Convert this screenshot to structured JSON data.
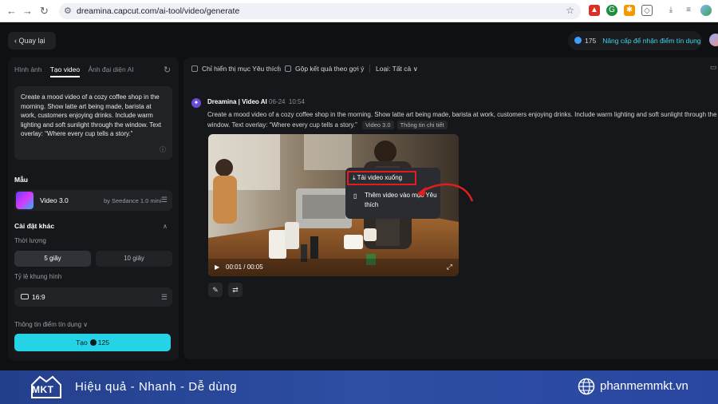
{
  "browser": {
    "url": "dreamina.capcut.com/ai-tool/video/generate"
  },
  "header": {
    "back_label": "Quay lại",
    "credits": "175",
    "upgrade_label": "Nâng cấp để nhận điểm tín dụng"
  },
  "left_panel": {
    "tabs": [
      "Hình ảnh",
      "Tạo video",
      "Ảnh đại diện AI"
    ],
    "prompt": "Create a mood video of a cozy coffee shop in the morning. Show latte art being made, barista at work, customers enjoying drinks. Include warm lighting and soft sunlight through the window. Text overlay: “Where every cup tells a story.”",
    "model_section": "Mẫu",
    "model_name": "Video 3.0",
    "model_sub": "by Seedance 1.0 mini",
    "other_settings": "Cài đặt khác",
    "duration_label": "Thời lượng",
    "duration_options": [
      "5 giây",
      "10 giây"
    ],
    "ratio_label": "Tỷ lệ khung hình",
    "ratio_value": "16:9",
    "credit_info": "Thông tin điểm tín dụng",
    "create_label": "Tạo",
    "create_cost": "125"
  },
  "right_panel": {
    "filters": {
      "favorites_only": "Chỉ hiển thị mục Yêu thích",
      "group_by_prompt": "Gộp kết quả theo gợi ý",
      "type_label": "Loại: Tất cả"
    },
    "generation": {
      "author": "Dreamina | Video AI",
      "date": "06-24",
      "time": "10:54",
      "prompt": "Create a mood video of a cozy coffee shop in the morning. Show latte art being made, barista at work, customers enjoying drinks. Include warm lighting and soft sunlight through the window. Text overlay: “Where every cup tells a story.”",
      "chip_model": "Video 3.0",
      "chip_details": "Thông tin chi tiết",
      "video_time": "00:01 / 00:05"
    },
    "context_menu": {
      "download": "Tải video xuống",
      "add_favorite": "Thêm video vào mục Yêu thích"
    }
  },
  "footer": {
    "logo_text": "MKT",
    "slogan": "Hiệu quả - Nhanh - Dễ dùng",
    "website": "phanmemmkt.vn"
  },
  "colors": {
    "accent": "#25d3e6",
    "highlight_box": "#e01e1e",
    "footer_bg": "#2d4ea3"
  }
}
